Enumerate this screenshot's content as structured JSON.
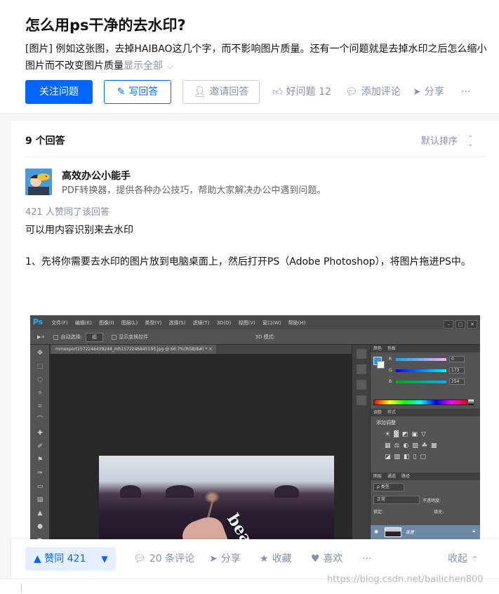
{
  "question": {
    "title": "怎么用ps干净的去水印?",
    "description": "[图片] 例如这张图，去掉HAIBAO这几个字，而不影响图片质量。还有一个问题就是去掉水印之后怎么缩小图片而不改变图片质量",
    "show_all": "显示全部",
    "follow_label": "关注问题",
    "write_label": "写回答",
    "invite_label": "邀请回答",
    "good_label": "好问题 12",
    "comment_label": "添加评论",
    "share_label": "分享",
    "more_label": "···"
  },
  "answers": {
    "count_label": "9 个回答",
    "sort_label": "默认排序"
  },
  "answer": {
    "author": "高效办公小能手",
    "headline": "PDF转换器，提供各种办公技巧，帮助大家解决办公中遇到问题。",
    "votes_text": "421 人赞同了该回答",
    "para1": "可以用内容识别来去水印",
    "para2": "1、先将你需要去水印的图片放到电脑桌面上，然后打开PS（Adobe Photoshop），将图片拖进PS中。"
  },
  "ps": {
    "logo": "Ps",
    "menus": [
      "文件(F)",
      "编辑(E)",
      "图像(I)",
      "图层(L)",
      "类型(Y)",
      "选择(S)",
      "滤镜(T)",
      "3D(D)",
      "视图(V)",
      "窗口(W)",
      "帮助(H)"
    ],
    "auto_select": "自动选择:",
    "auto_select_value": "组",
    "show_transform": "显示变换控件",
    "mode_3d": "3D 模式:",
    "doc_tab": "mmexport1572246439244_mh1572246845193.jpg @ 66.7%(RGB/8#) * ×",
    "watermark_text": "beautiful",
    "color_tab": "颜色",
    "swatch_tab": "色板",
    "r_label": "R",
    "g_label": "G",
    "b_label": "B",
    "r_value": "0",
    "g_value": "173",
    "b_value": "254",
    "adjust_tab": "调整",
    "style_tab": "样式",
    "add_adjust": "添加调整",
    "layers_tab": "图层",
    "channels_tab": "通道",
    "paths_tab": "路径",
    "kind_label": "ρ 类型",
    "blend_mode": "正常",
    "opacity_label": "不透明度:",
    "lock_label": "锁定:",
    "fill_label": "填充:",
    "layer_name": "背景"
  },
  "bottom_bar": {
    "upvote_label": "▲ 赞同 421",
    "downvote_label": "▼",
    "comments_label": "20 条评论",
    "share_label": "分享",
    "collect_label": "收藏",
    "like_label": "喜欢",
    "more_label": "···",
    "collapse_label": "收起"
  },
  "watermark": "https://blog.csdn.net/bailichen800",
  "colors": {
    "brand_blue": "#0066ff",
    "muted": "#8590a6",
    "ps_blue": "#31a8ff"
  }
}
